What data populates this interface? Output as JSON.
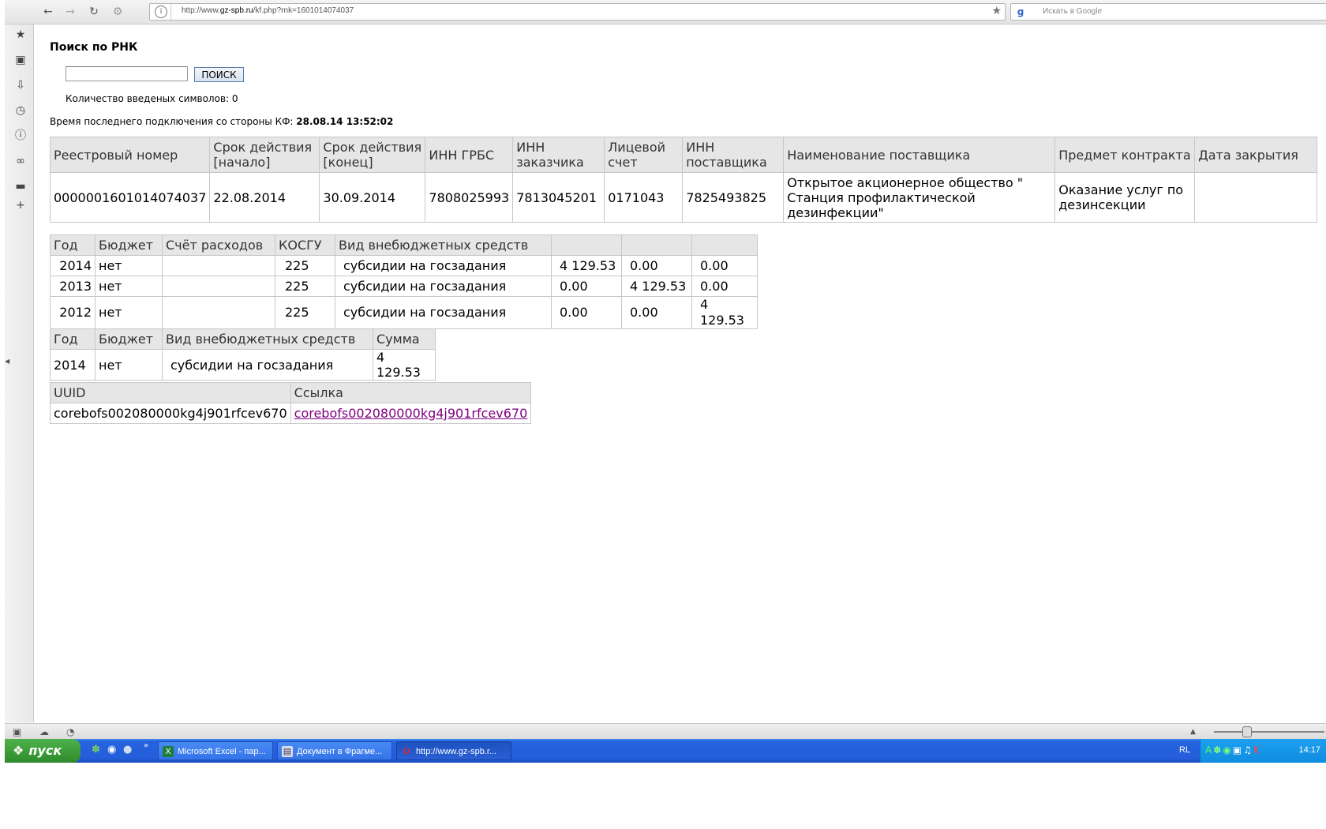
{
  "browser": {
    "url_prefix": "http://www.",
    "url_domain": "gz-spb.ru",
    "url_path": "/kf.php?rnk=1601014074037",
    "search_placeholder": "Искать в Google"
  },
  "page": {
    "title": "Поиск по РНК",
    "search_input_value": "",
    "search_button_label": "ПОИСК",
    "count_label": "Количество введеных символов: 0",
    "last_connection_label": "Время последнего подключения со стороны КФ:",
    "last_connection_value": "28.08.14 13:52:02"
  },
  "contract_table": {
    "headers": [
      "Реестровый номер",
      "Срок действия [начало]",
      "Срок действия [конец]",
      "ИНН ГРБС",
      "ИНН заказчика",
      "Лицевой счет",
      "ИНН поставщика",
      "Наименование поставщика",
      "Предмет контракта",
      "Дата закрытия"
    ],
    "row": [
      "0000001601014074037",
      "22.08.2014",
      "30.09.2014",
      "7808025993",
      "7813045201",
      "0171043",
      "7825493825",
      "Открытое акционерное общество \" Станция профилактической дезинфекции\"",
      "Оказание услуг по дезинсекции",
      ""
    ]
  },
  "budget_table": {
    "headers": [
      "Год",
      "Бюджет",
      "Счёт расходов",
      "КОСГУ",
      "Вид внебюджетных средств",
      "",
      "",
      ""
    ],
    "rows": [
      [
        "2014",
        "нет",
        "",
        "225",
        "субсидии на госзадания",
        "4 129.53",
        "0.00",
        "0.00"
      ],
      [
        "2013",
        "нет",
        "",
        "225",
        "субсидии на госзадания",
        "0.00",
        "4 129.53",
        "0.00"
      ],
      [
        "2012",
        "нет",
        "",
        "225",
        "субсидии на госзадания",
        "0.00",
        "0.00",
        "4 129.53"
      ]
    ]
  },
  "sum_table": {
    "headers": [
      "Год",
      "Бюджет",
      "Вид внебюджетных средств",
      "Сумма"
    ],
    "row": [
      "2014",
      "нет",
      "субсидии на госзадания",
      "4 129.53"
    ]
  },
  "uuid_table": {
    "headers": [
      "UUID",
      "Ссылка"
    ],
    "row": [
      "corebofs002080000kg4j901rfcev670",
      "corebofs002080000kg4j901rfcev670"
    ]
  },
  "taskbar": {
    "start_label": "пуск",
    "tasks": [
      "Microsoft Excel - пар...",
      "Документ в Фрагме...",
      "http://www.gz-spb.r..."
    ],
    "lang": "RL",
    "clock": "14:17"
  }
}
